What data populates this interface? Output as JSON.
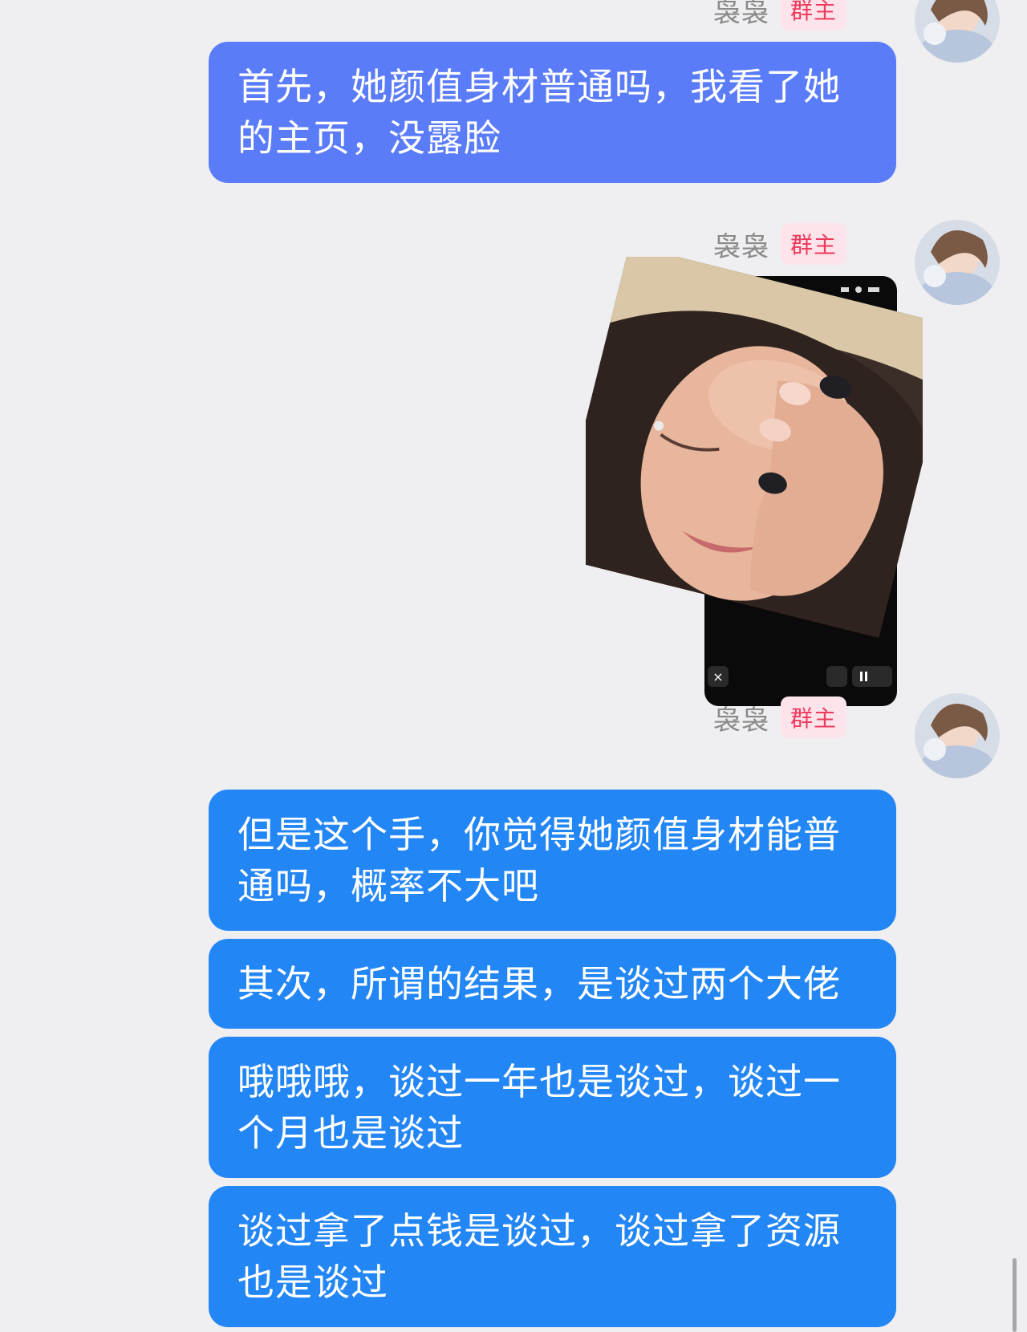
{
  "chat": {
    "sender_name": "袅袅",
    "sender_badge": "群主",
    "messages": [
      {
        "text": "首先，她颜值身材普通吗，我看了她的主页，没露脸"
      },
      {
        "text": "但是这个手，你觉得她颜值身材能普通吗，概率不大吧"
      },
      {
        "text": "其次，所谓的结果，是谈过两个大佬"
      },
      {
        "text": "哦哦哦，谈过一年也是谈过，谈过一个月也是谈过"
      },
      {
        "text": "谈过拿了点钱是谈过，谈过拿了资源也是谈过"
      }
    ]
  },
  "colors": {
    "background": "#efeff1",
    "bubble_purple": "#5b7cf9",
    "bubble_blue": "#2386f5",
    "badge_text": "#ee3a5c",
    "badge_bg": "#fde4ea"
  }
}
